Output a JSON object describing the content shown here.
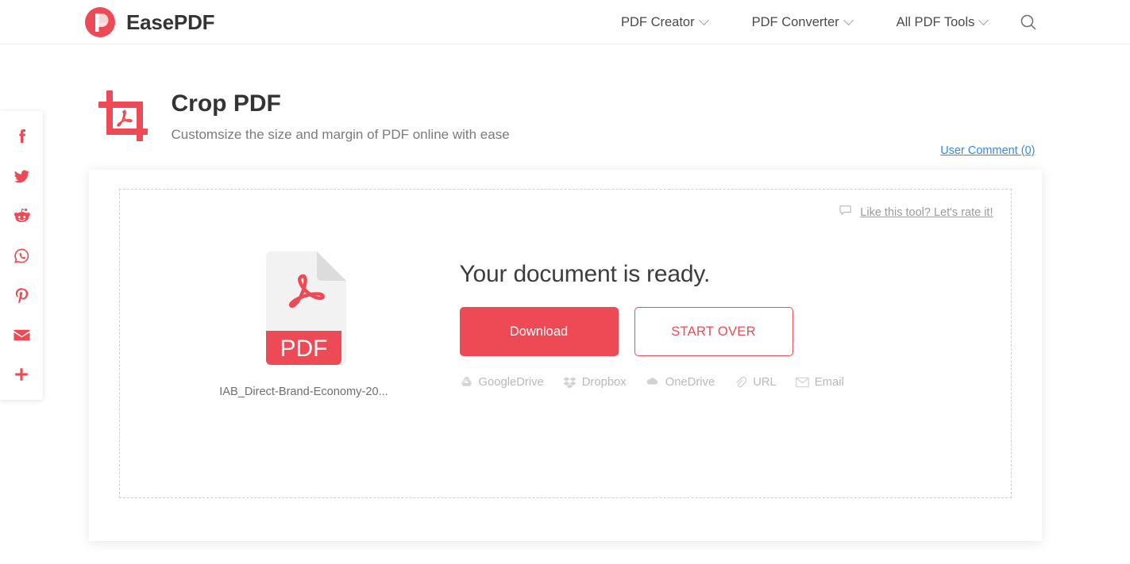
{
  "header": {
    "brand": {
      "name": "EasePDF",
      "logo_icon": "easepdf-logo-icon",
      "logo_color": "#ee4a56"
    },
    "nav": [
      {
        "label": "PDF Creator",
        "icon": "chevron-down-icon"
      },
      {
        "label": "PDF Converter",
        "icon": "chevron-down-icon"
      },
      {
        "label": "All PDF Tools",
        "icon": "chevron-down-icon"
      }
    ],
    "search_icon": "search-icon"
  },
  "social_rail": {
    "items": [
      {
        "name": "facebook",
        "icon": "facebook-icon"
      },
      {
        "name": "twitter",
        "icon": "twitter-icon"
      },
      {
        "name": "reddit",
        "icon": "reddit-icon"
      },
      {
        "name": "whatsapp",
        "icon": "whatsapp-icon"
      },
      {
        "name": "pinterest",
        "icon": "pinterest-icon"
      },
      {
        "name": "email",
        "icon": "email-icon"
      },
      {
        "name": "more",
        "icon": "plus-icon"
      }
    ],
    "color": "#ee4a56"
  },
  "tool": {
    "icon": "crop-pdf-icon",
    "title": "Crop PDF",
    "subtitle": "Customsize the size and margin of PDF online with ease",
    "user_comment_label": "User Comment (0)",
    "user_comment_color": "#2d8cf0"
  },
  "card": {
    "rate": {
      "icon": "comment-bubble-icon",
      "label": "Like this tool? Let's rate it!"
    },
    "file": {
      "thumb_icon": "pdf-file-icon",
      "thumb_label": "PDF",
      "name": "IAB_Direct-Brand-Economy-20..."
    },
    "result": {
      "title": "Your document is ready.",
      "download_label": "Download",
      "start_over_label": "START OVER",
      "download_color": "#ee4a56"
    },
    "destinations": [
      {
        "label": "GoogleDrive",
        "icon": "google-drive-icon"
      },
      {
        "label": "Dropbox",
        "icon": "dropbox-icon"
      },
      {
        "label": "OneDrive",
        "icon": "onedrive-icon"
      },
      {
        "label": "URL",
        "icon": "link-icon"
      },
      {
        "label": "Email",
        "icon": "envelope-icon"
      }
    ]
  }
}
